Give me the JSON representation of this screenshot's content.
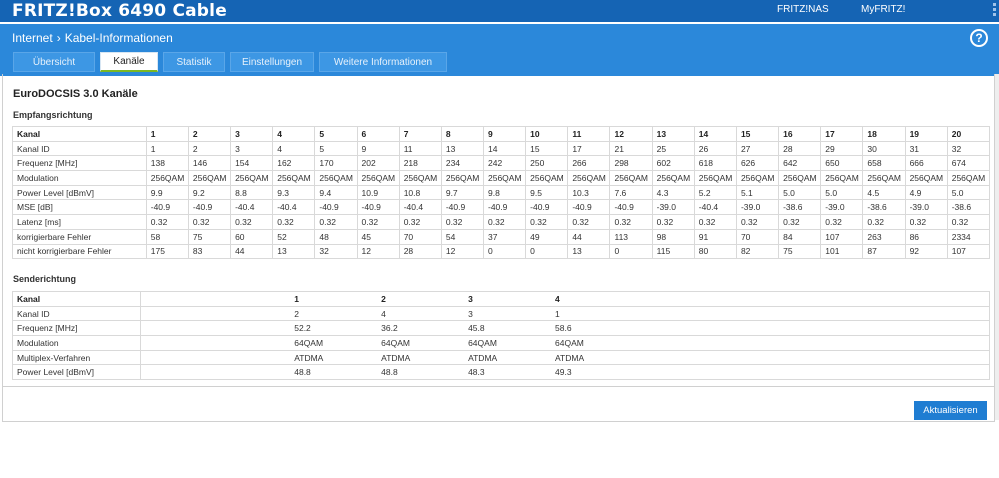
{
  "header": {
    "title": "FRITZ!Box 6490 Cable",
    "links": [
      "FRITZ!NAS",
      "MyFRITZ!"
    ]
  },
  "breadcrumb": {
    "parent": "Internet",
    "current": "Kabel-Informationen"
  },
  "tabs": [
    "Übersicht",
    "Kanäle",
    "Statistik",
    "Einstellungen",
    "Weitere Informationen"
  ],
  "active_tab": "Kanäle",
  "section_title": "EuroDOCSIS 3.0 Kanäle",
  "downstream": {
    "title": "Empfangsrichtung",
    "header_label": "Kanal",
    "channels": [
      "1",
      "2",
      "3",
      "4",
      "5",
      "6",
      "7",
      "8",
      "9",
      "10",
      "11",
      "12",
      "13",
      "14",
      "15",
      "16",
      "17",
      "18",
      "19",
      "20"
    ],
    "rows": [
      {
        "label": "Kanal ID",
        "values": [
          "1",
          "2",
          "3",
          "4",
          "5",
          "9",
          "11",
          "13",
          "14",
          "15",
          "17",
          "21",
          "25",
          "26",
          "27",
          "28",
          "29",
          "30",
          "31",
          "32"
        ]
      },
      {
        "label": "Frequenz [MHz]",
        "values": [
          "138",
          "146",
          "154",
          "162",
          "170",
          "202",
          "218",
          "234",
          "242",
          "250",
          "266",
          "298",
          "602",
          "618",
          "626",
          "642",
          "650",
          "658",
          "666",
          "674"
        ]
      },
      {
        "label": "Modulation",
        "values": [
          "256QAM",
          "256QAM",
          "256QAM",
          "256QAM",
          "256QAM",
          "256QAM",
          "256QAM",
          "256QAM",
          "256QAM",
          "256QAM",
          "256QAM",
          "256QAM",
          "256QAM",
          "256QAM",
          "256QAM",
          "256QAM",
          "256QAM",
          "256QAM",
          "256QAM",
          "256QAM"
        ]
      },
      {
        "label": "Power Level [dBmV]",
        "values": [
          "9.9",
          "9.2",
          "8.8",
          "9.3",
          "9.4",
          "10.9",
          "10.8",
          "9.7",
          "9.8",
          "9.5",
          "10.3",
          "7.6",
          "4.3",
          "5.2",
          "5.1",
          "5.0",
          "5.0",
          "4.5",
          "4.9",
          "5.0"
        ]
      },
      {
        "label": "MSE [dB]",
        "values": [
          "-40.9",
          "-40.9",
          "-40.4",
          "-40.4",
          "-40.9",
          "-40.9",
          "-40.4",
          "-40.9",
          "-40.9",
          "-40.9",
          "-40.9",
          "-40.9",
          "-39.0",
          "-40.4",
          "-39.0",
          "-38.6",
          "-39.0",
          "-38.6",
          "-39.0",
          "-38.6"
        ]
      },
      {
        "label": "Latenz [ms]",
        "values": [
          "0.32",
          "0.32",
          "0.32",
          "0.32",
          "0.32",
          "0.32",
          "0.32",
          "0.32",
          "0.32",
          "0.32",
          "0.32",
          "0.32",
          "0.32",
          "0.32",
          "0.32",
          "0.32",
          "0.32",
          "0.32",
          "0.32",
          "0.32"
        ]
      },
      {
        "label": "korrigierbare Fehler",
        "values": [
          "58",
          "75",
          "60",
          "52",
          "48",
          "45",
          "70",
          "54",
          "37",
          "49",
          "44",
          "113",
          "98",
          "91",
          "70",
          "84",
          "107",
          "263",
          "86",
          "2334"
        ]
      },
      {
        "label": "nicht korrigierbare Fehler",
        "values": [
          "175",
          "83",
          "44",
          "13",
          "32",
          "12",
          "28",
          "12",
          "0",
          "0",
          "13",
          "0",
          "115",
          "80",
          "82",
          "75",
          "101",
          "87",
          "92",
          "107"
        ]
      }
    ]
  },
  "upstream": {
    "title": "Senderichtung",
    "header_label": "Kanal",
    "channels": [
      "1",
      "2",
      "3",
      "4"
    ],
    "rows": [
      {
        "label": "Kanal ID",
        "values": [
          "2",
          "4",
          "3",
          "1"
        ]
      },
      {
        "label": "Frequenz [MHz]",
        "values": [
          "52.2",
          "36.2",
          "45.8",
          "58.6"
        ]
      },
      {
        "label": "Modulation",
        "values": [
          "64QAM",
          "64QAM",
          "64QAM",
          "64QAM"
        ]
      },
      {
        "label": "Multiplex-Verfahren",
        "values": [
          "ATDMA",
          "ATDMA",
          "ATDMA",
          "ATDMA"
        ]
      },
      {
        "label": "Power Level [dBmV]",
        "values": [
          "48.8",
          "48.8",
          "48.3",
          "49.3"
        ]
      }
    ]
  },
  "refresh_button": "Aktualisieren",
  "colors": {
    "header": "#1564b4",
    "subheader": "#2b88da",
    "active_tab_underline": "#7bb824",
    "button": "#1f7dd2"
  }
}
